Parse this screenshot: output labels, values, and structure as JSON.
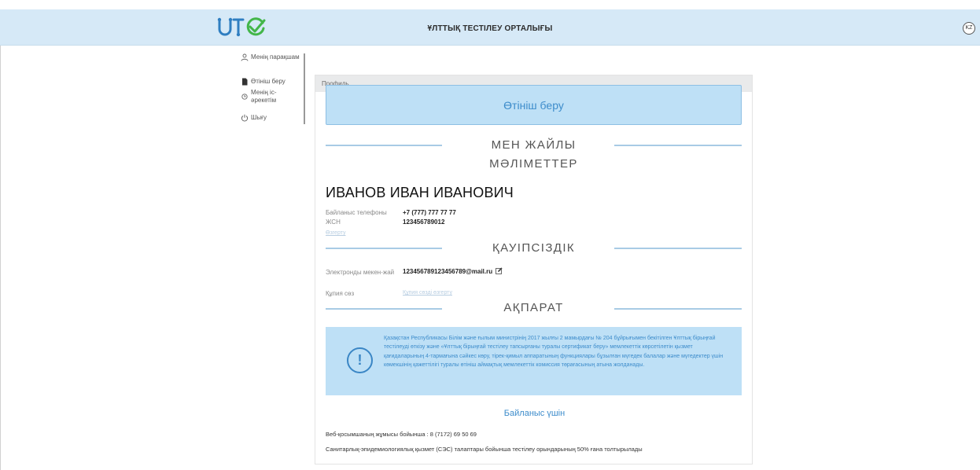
{
  "header": {
    "title": "ҰЛТТЫҚ ТЕСТІЛЕУ ОРТАЛЫҒЫ",
    "lang": "KZ",
    "logo_icon": "utc-logo-icon",
    "colors": {
      "logo_blue": "#2f7ec1",
      "logo_green": "#43b649",
      "header_bg": "#d6e9f7"
    }
  },
  "sidebar": {
    "items": [
      {
        "label": "Менің парақшам",
        "icon": "user-icon"
      },
      {
        "label": "Өтініш беру",
        "icon": "document-icon"
      },
      {
        "label": "Менің іс-әрекетім",
        "icon": "clock-icon"
      },
      {
        "label": "Шығу",
        "icon": "power-icon"
      }
    ]
  },
  "profile": {
    "breadcrumb": "Профиль",
    "apply_button": "Өтініш беру",
    "personal_section": "МЕН ЖАЙЛЫ МӘЛІМЕТТЕР",
    "full_name": "ИВАНОВ ИВАН ИВАНОВИЧ",
    "phone_label": "Байланыс телефоны",
    "phone_value": "+7 (777) 777 77 77",
    "iin_label": "ЖСН",
    "iin_value": "123456789012",
    "change_link": "Өзгерту",
    "security_section": "ҚАУІПСІЗДІК",
    "email_label": "Электронды мекен-жай",
    "email_value": "123456789123456789@mail.ru",
    "password_label": "Құпия сөз",
    "password_link": "Құпия сөзді өзгерту",
    "info_section": "АҚПАРАТ",
    "info_text": "Қазақстан Республикасы Білім және ғылым министрінің 2017 жылғы 2 мамырдағы № 204 бұйрығымен бекітілген Ұлттық бірыңғай тестілеуді өткізу және «Ұлттық бірыңғай тестілеу тапсырғаны туралы сертификат беру» мемлекеттік көрсетілетін қызмет қағидаларының 4-тармағына сәйкес көру, тірек-қимыл аппаратының функциялары бұзылған мүгедек балалар және мүгедектер үшін көмекшінің қажеттілігі туралы өтініш аймақтық мемлекеттік комиссия төрағасының атына жолданады.",
    "contact_title": "Байланыс үшін",
    "contact_line1": "Веб-қосымшаның жұмысы бойынша : 8 (7172) 69 50 69",
    "contact_line2": "Санитарлық-эпидемиологиялық қызмет (СЭС) талаптары бойынша тестілеу орындарының 50% ғана толтырылады"
  }
}
